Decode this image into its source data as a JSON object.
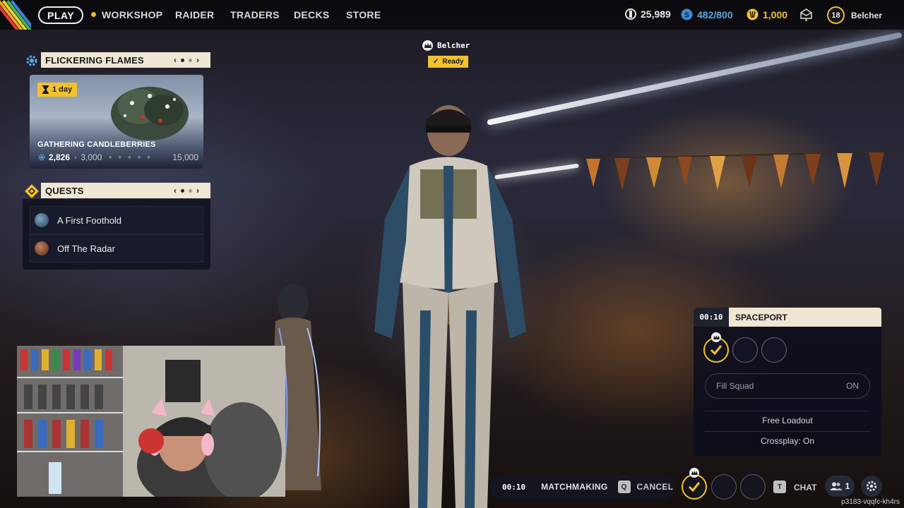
{
  "topbar": {
    "play_label": "PLAY",
    "nav": [
      {
        "label": "WORKSHOP"
      },
      {
        "label": "RAIDER"
      },
      {
        "label": "TRADERS"
      },
      {
        "label": "DECKS"
      },
      {
        "label": "STORE"
      }
    ],
    "currencies": [
      {
        "icon": "coins-icon",
        "value": "25,989",
        "color": "#e8e8e8"
      },
      {
        "icon": "storage-icon",
        "value": "482/800",
        "color": "#5aa9e6"
      },
      {
        "icon": "raider-tokens-icon",
        "value": "1,000",
        "color": "#f2c12e"
      }
    ],
    "level": "18",
    "username": "Belcher"
  },
  "event_panel": {
    "title": "FLICKERING FLAMES",
    "timer": "1 day",
    "event_name": "GATHERING CANDLEBERRIES",
    "progress_current": "2,826",
    "progress_next": "3,000",
    "progress_max": "15,000",
    "progress_fraction": 0.19
  },
  "quests_panel": {
    "title": "QUESTS",
    "items": [
      {
        "label": "A First Foothold"
      },
      {
        "label": "Off The Radar"
      }
    ]
  },
  "lobby": {
    "player_name": "Belcher",
    "ready_label": "Ready"
  },
  "squad_panel": {
    "timer": "00:10",
    "destination": "SPACEPORT",
    "fill_squad_label": "Fill Squad",
    "fill_squad_value": "ON",
    "free_loadout_label": "Free Loadout",
    "crossplay_label": "Crossplay: On"
  },
  "matchmaking": {
    "timer": "00:10",
    "label": "MATCHMAKING",
    "cancel_key": "Q",
    "cancel_label": "CANCEL",
    "chat_key": "T",
    "chat_label": "CHAT",
    "friends_count": "1"
  },
  "session_id": "p3183-vqqfc-kh4rs",
  "colors": {
    "accent": "#f2c12e",
    "panel_header": "#efe6d3",
    "panel_bg": "#0e101c"
  }
}
